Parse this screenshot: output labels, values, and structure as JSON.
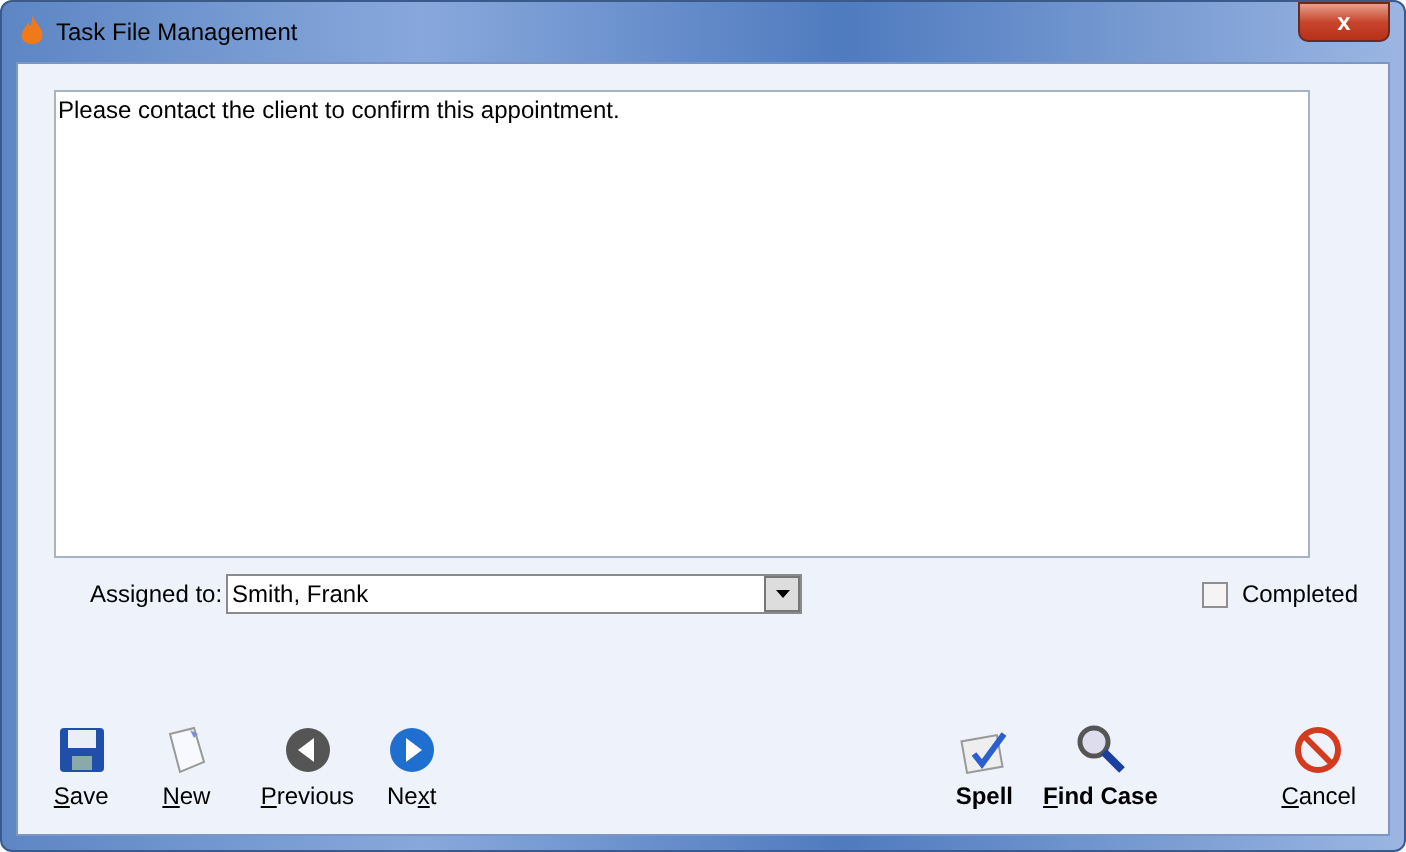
{
  "window": {
    "title": "Task File Management",
    "close": "x"
  },
  "note": {
    "value": "Please contact the client to confirm this appointment."
  },
  "assigned": {
    "label": "Assigned to:",
    "value": "Smith, Frank"
  },
  "completed": {
    "label": "Completed",
    "checked": false
  },
  "buttons": [
    {
      "kind": "save",
      "key": "S",
      "after": "ave",
      "bold": false
    },
    {
      "kind": "new",
      "key": "N",
      "after": "ew",
      "bold": false
    },
    {
      "kind": "previous",
      "key": "P",
      "after": "revious",
      "bold": false
    },
    {
      "kind": "next",
      "before": "Ne",
      "key": "x",
      "after": "t",
      "bold": false
    },
    {
      "kind": "spell",
      "before": "Spell",
      "bold": true
    },
    {
      "kind": "find",
      "key": "F",
      "after": "ind Case",
      "bold": true
    },
    {
      "kind": "cancel",
      "key": "C",
      "after": "ancel",
      "bold": false
    }
  ]
}
